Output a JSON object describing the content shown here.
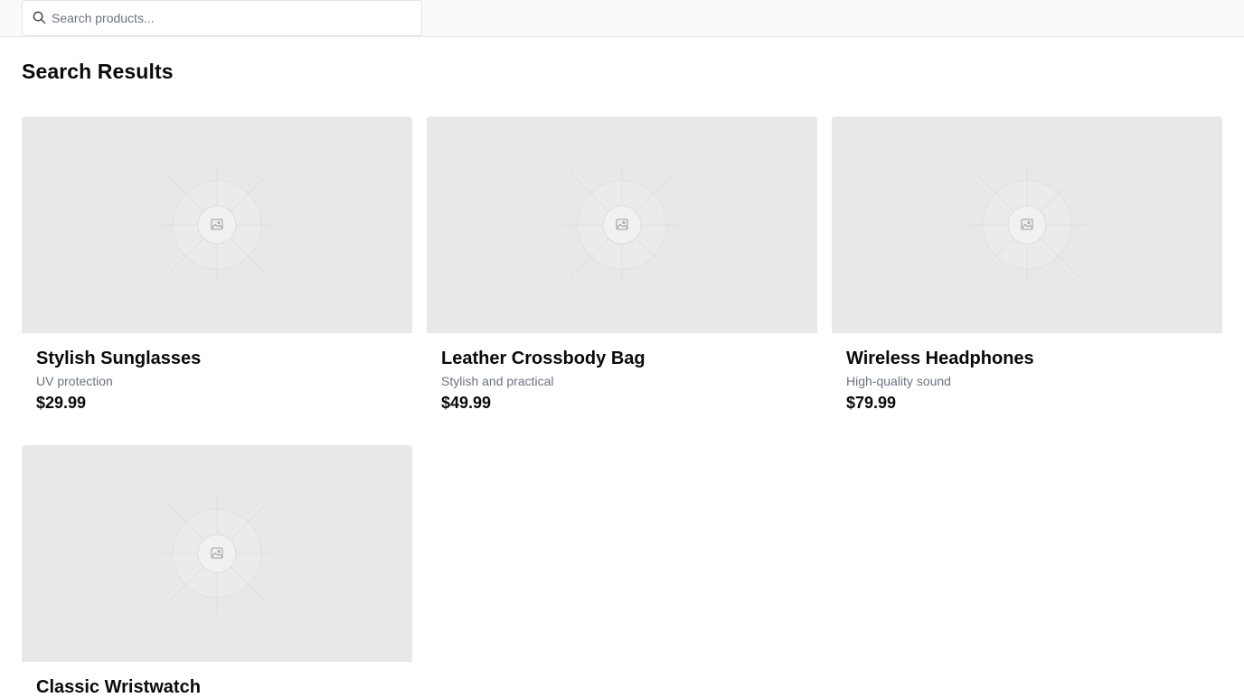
{
  "search": {
    "placeholder": "Search products..."
  },
  "main": {
    "title": "Search Results"
  },
  "products": [
    {
      "name": "Stylish Sunglasses",
      "description": "UV protection",
      "price": "$29.99"
    },
    {
      "name": "Leather Crossbody Bag",
      "description": "Stylish and practical",
      "price": "$49.99"
    },
    {
      "name": "Wireless Headphones",
      "description": "High-quality sound",
      "price": "$79.99"
    },
    {
      "name": "Classic Wristwatch",
      "description": "",
      "price": ""
    }
  ],
  "icons": {
    "search": "search-icon",
    "placeholder_image": "image-icon"
  },
  "colors": {
    "placeholder_bg": "#e8e8e8",
    "muted_text": "#6b7280"
  }
}
